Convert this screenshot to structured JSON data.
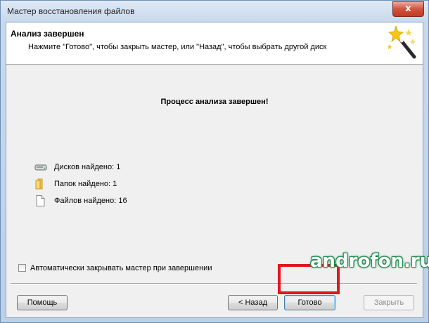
{
  "window": {
    "title": "Мастер восстановления файлов",
    "close_glyph": "x"
  },
  "header": {
    "title": "Анализ завершен",
    "subtitle": "Нажмите \"Готово\", чтобы закрыть мастер, или \"Назад\", чтобы выбрать другой диск",
    "icon": "magic-wand-icon"
  },
  "main": {
    "message": "Процесс анализа завершен!",
    "stats": [
      {
        "icon": "drive-icon",
        "label": "Дисков найдено: 1"
      },
      {
        "icon": "folder-icon",
        "label": "Папок найдено: 1"
      },
      {
        "icon": "file-icon",
        "label": "Файлов найдено: 16"
      }
    ],
    "auto_close": {
      "label": "Автоматически закрывать мастер при завершении",
      "checked": false
    }
  },
  "buttons": {
    "help": "Помощь",
    "back": "< Назад",
    "finish": "Готово",
    "close": "Закрыть"
  },
  "overlay": {
    "watermark": "androfon.ru",
    "highlight_color": "#e1161f",
    "watermark_color": "#1f8a4a"
  }
}
